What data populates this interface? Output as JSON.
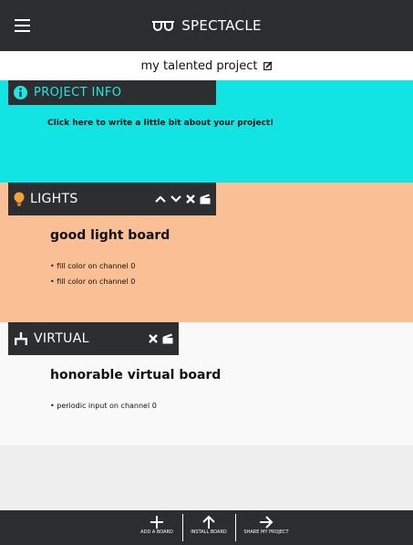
{
  "app": {
    "brand": "SPECTACLE",
    "project_name": "my talented project"
  },
  "project_info": {
    "title": "PROJECT INFO",
    "placeholder": "Click here to write a little bit about your project!",
    "color": "#12e4e4"
  },
  "boards": [
    {
      "type_label": "LIGHTS",
      "name": "good light board",
      "color": "#fbbf95",
      "items": [
        "• fill color on channel 0",
        "• fill color on channel 0"
      ]
    },
    {
      "type_label": "VIRTUAL",
      "name": "honorable virtual board",
      "color": "#f9f9f9",
      "items": [
        "• periodic input on channel 0"
      ]
    }
  ],
  "toolbar": {
    "buttons": [
      {
        "icon": "plus-icon",
        "label": "ADD A BOARD"
      },
      {
        "icon": "arrow-up-icon",
        "label": "INSTALL BOARD"
      },
      {
        "icon": "arrow-right-icon",
        "label": "SHARE MY PROJECT"
      }
    ]
  },
  "colors": {
    "header": "#2b2d2f",
    "tab": "#2d2e30"
  }
}
